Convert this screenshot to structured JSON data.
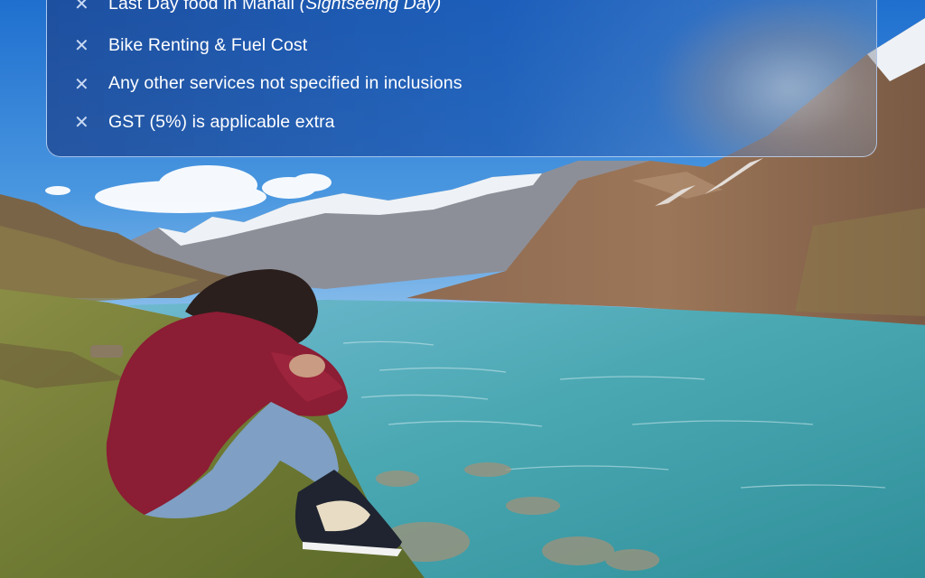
{
  "exclusions": {
    "icon": "close-icon",
    "items": [
      {
        "text": "Last Day food in Manali ",
        "emphasis": "(Sightseeing Day)"
      },
      {
        "text": "Bike Renting & Fuel Cost",
        "emphasis": ""
      },
      {
        "text": "Any other services not specified in inclusions",
        "emphasis": ""
      },
      {
        "text": "GST (5%) is applicable extra",
        "emphasis": ""
      }
    ],
    "glyph": "✕"
  },
  "colors": {
    "sky": "#2f7fd0",
    "card": "#1f56a8",
    "lake": "#4fb3b6",
    "sweater": "#8b1d34",
    "grass": "#7a8a3c"
  }
}
